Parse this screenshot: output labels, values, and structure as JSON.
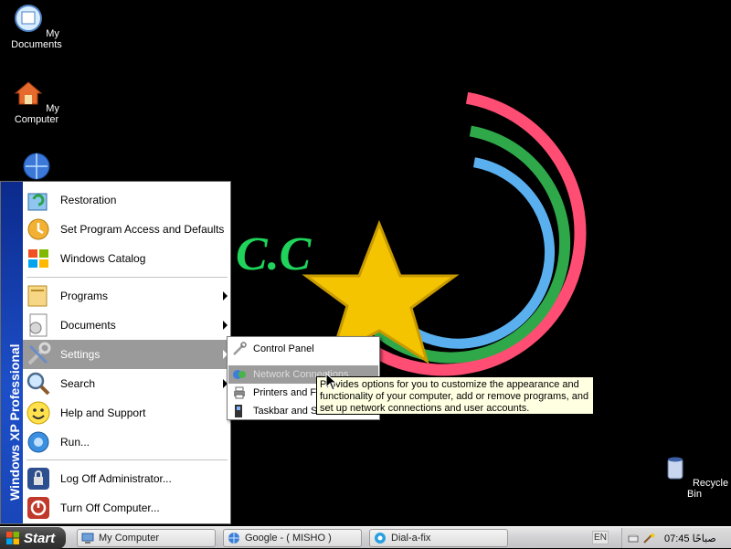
{
  "desktop": {
    "icons": [
      {
        "label": "My Documents",
        "icon": "my-documents-icon"
      },
      {
        "label": "My Computer",
        "icon": "my-computer-icon"
      },
      {
        "label": "",
        "icon": "network-places-icon"
      },
      {
        "label": "Recycle Bin",
        "icon": "recycle-bin-icon"
      }
    ],
    "wallpaper_text": "C.C"
  },
  "start_menu": {
    "banner": "Windows XP Professional",
    "pinned": [
      {
        "label": "Restoration",
        "icon": "restoration-icon"
      },
      {
        "label": "Set Program Access and Defaults",
        "icon": "program-access-icon"
      },
      {
        "label": "Windows Catalog",
        "icon": "windows-catalog-icon"
      }
    ],
    "items": [
      {
        "label": "Programs",
        "icon": "programs-icon",
        "submenu": true
      },
      {
        "label": "Documents",
        "icon": "documents-icon",
        "submenu": true
      },
      {
        "label": "Settings",
        "icon": "settings-icon",
        "submenu": true,
        "highlighted": true
      },
      {
        "label": "Search",
        "icon": "search-icon",
        "submenu": true
      },
      {
        "label": "Help and Support",
        "icon": "help-icon"
      },
      {
        "label": "Run...",
        "icon": "run-icon"
      }
    ],
    "bottom": [
      {
        "label": "Log Off Administrator...",
        "icon": "log-off-icon"
      },
      {
        "label": "Turn Off Computer...",
        "icon": "turn-off-icon"
      }
    ]
  },
  "settings_submenu": [
    {
      "label": "Control Panel",
      "icon": "control-panel-icon"
    },
    {
      "label": "Network Connections",
      "icon": "network-connections-icon",
      "highlighted": true
    },
    {
      "label": "Printers and Faxes",
      "icon": "printers-icon"
    },
    {
      "label": "Taskbar and Start Menu",
      "icon": "taskbar-icon"
    }
  ],
  "tooltip": {
    "text": "Provides options for you to customize the appearance and functionality of your computer, add or remove programs, and set up network connections and user accounts."
  },
  "taskbar": {
    "start_label": "Start",
    "tasks": [
      {
        "label": "My Computer",
        "icon": "my-computer-icon"
      },
      {
        "label": "Google - ( MISHO )",
        "icon": "browser-icon"
      },
      {
        "label": "Dial-a-fix",
        "icon": "dial-a-fix-icon"
      }
    ],
    "language": "EN",
    "clock": "07:45 صباحًا"
  },
  "colors": {
    "menu_highlight": "#9a9a9a",
    "banner_blue": "#1d4fc9",
    "tooltip_bg": "#ffffe1",
    "ring_pink": "#ff4d73",
    "ring_green": "#2fa84a",
    "ring_blue": "#5ab0ef",
    "star_yellow": "#f5c400"
  }
}
